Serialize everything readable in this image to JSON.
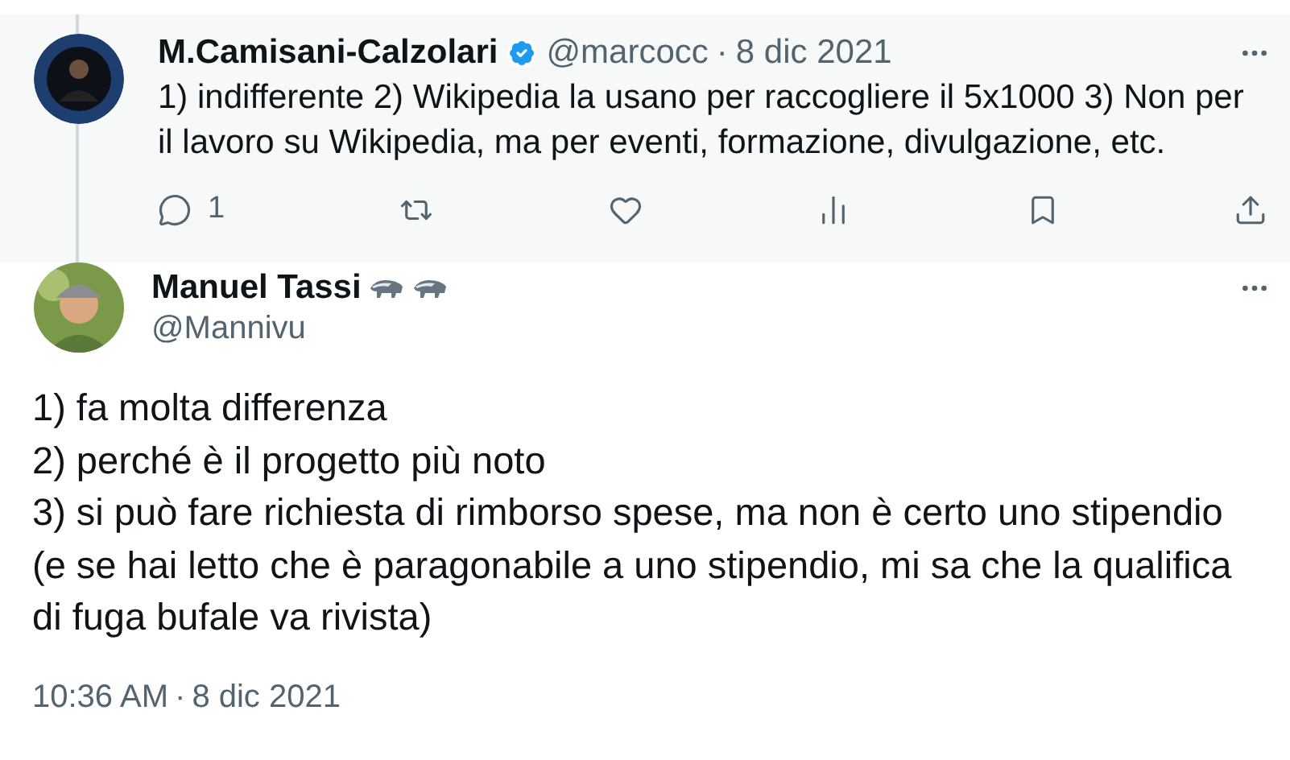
{
  "parent_tweet": {
    "name": "M.Camisani-Calzolari",
    "verified": true,
    "handle": "@marcocc",
    "separator": "·",
    "date": "8 dic 2021",
    "text": "1) indifferente 2) Wikipedia la usano per raccogliere il 5x1000 3) Non per il lavoro su Wikipedia, ma per eventi, formazione, divulgazione, etc.",
    "actions": [
      {
        "kind": "reply",
        "count": "1"
      },
      {
        "kind": "retweet"
      },
      {
        "kind": "like"
      },
      {
        "kind": "views"
      },
      {
        "kind": "bookmark"
      },
      {
        "kind": "share"
      }
    ]
  },
  "tweet": {
    "name": "Manuel Tassi",
    "name_badges": [
      {
        "kind": "badger"
      },
      {
        "kind": "badger"
      }
    ],
    "handle": "@Mannivu",
    "lines": [
      "1) fa molta differenza",
      "2) perché è il progetto più noto",
      "3) si può fare richiesta di rimborso spese, ma non è certo uno stipendio",
      "(e se hai letto che è paragonabile a uno stipendio, mi sa che la qualifica di fuga bufale va rivista)"
    ],
    "time": "10:36 AM",
    "separator": "·",
    "date": "8 dic 2021"
  }
}
